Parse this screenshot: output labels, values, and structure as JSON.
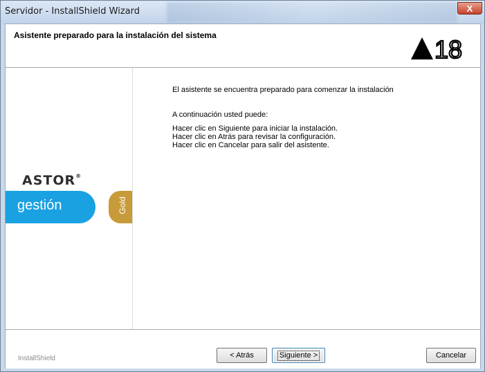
{
  "window": {
    "title": "Servidor - InstallShield Wizard",
    "close_glyph": "X"
  },
  "header": {
    "title": "Asistente preparado para la instalación del sistema",
    "logo_text": "18"
  },
  "left_panel": {
    "brand": "ASTOR",
    "brand_mark": "®",
    "product": "gestión",
    "edition": "Gold"
  },
  "content": {
    "ready_text": "El asistente se encuentra preparado para comenzar la instalación",
    "intro": "A continuación usted puede:",
    "instructions": [
      "Hacer clic en Siguiente para iniciar la instalación.",
      "Hacer clic en Atrás para revisar la configuración.",
      "Hacer clic en Cancelar para salir del asistente."
    ]
  },
  "footer": {
    "brand": "InstallShield",
    "back_label": "< Atrás",
    "next_label": "Siguiente >",
    "cancel_label": "Cancelar"
  },
  "colors": {
    "gestion_blue": "#1aa1e2",
    "gold": "#c79a3a"
  }
}
